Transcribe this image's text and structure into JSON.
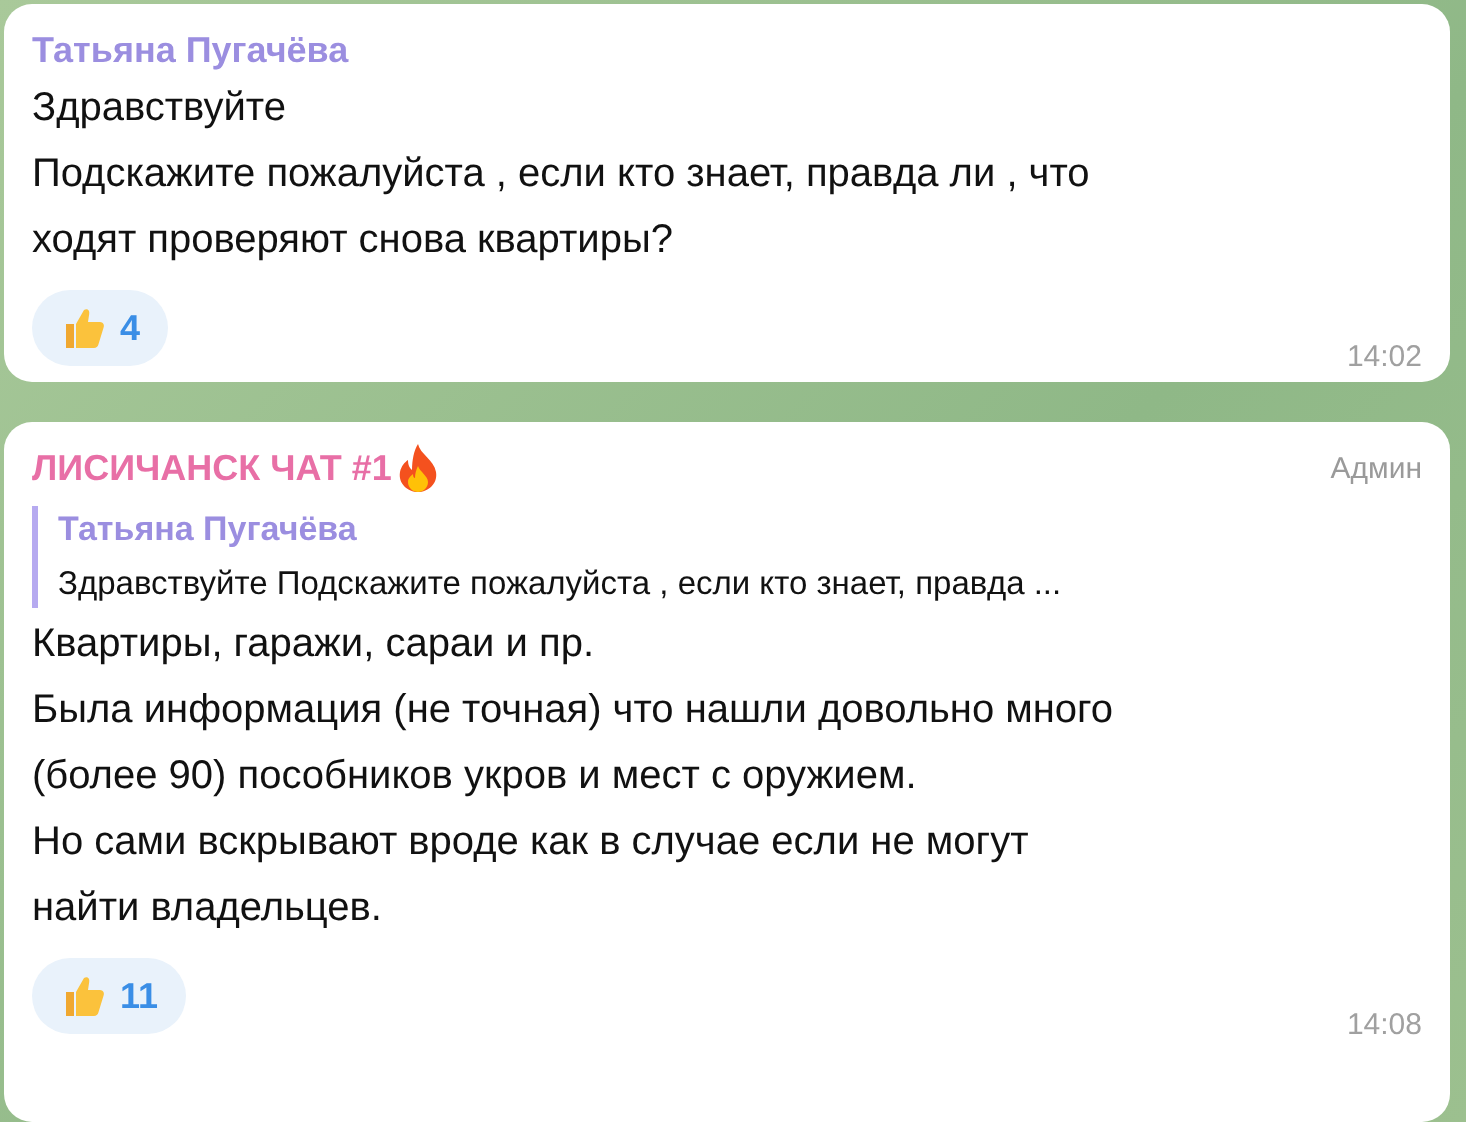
{
  "messages": [
    {
      "sender": "Татьяна Пугачёва",
      "kind": "member",
      "color": "#9b8ee0",
      "lines": [
        "Здравствуйте",
        "Подскажите пожалуйста , если кто знает, правда ли , что",
        "ходят проверяют снова квартиры?"
      ],
      "reaction": {
        "count": "4"
      },
      "time": "14:02"
    },
    {
      "sender": "ЛИСИЧАНСК ЧАТ #1",
      "kind": "admin",
      "color": "#e86fa6",
      "role": "Админ",
      "reply": {
        "sender": "Татьяна Пугачёва",
        "text": "Здравствуйте Подскажите пожалуйста , если кто знает, правда ..."
      },
      "lines": [
        "Квартиры, гаражи, сараи и пр.",
        "Была информация (не точная) что нашли довольно много",
        "(более 90) пособников укров и мест с оружием.",
        "Но сами вскрывают вроде как в случае если не могут",
        "найти владельцев."
      ],
      "reaction": {
        "count": "11"
      },
      "time": "14:08"
    }
  ]
}
